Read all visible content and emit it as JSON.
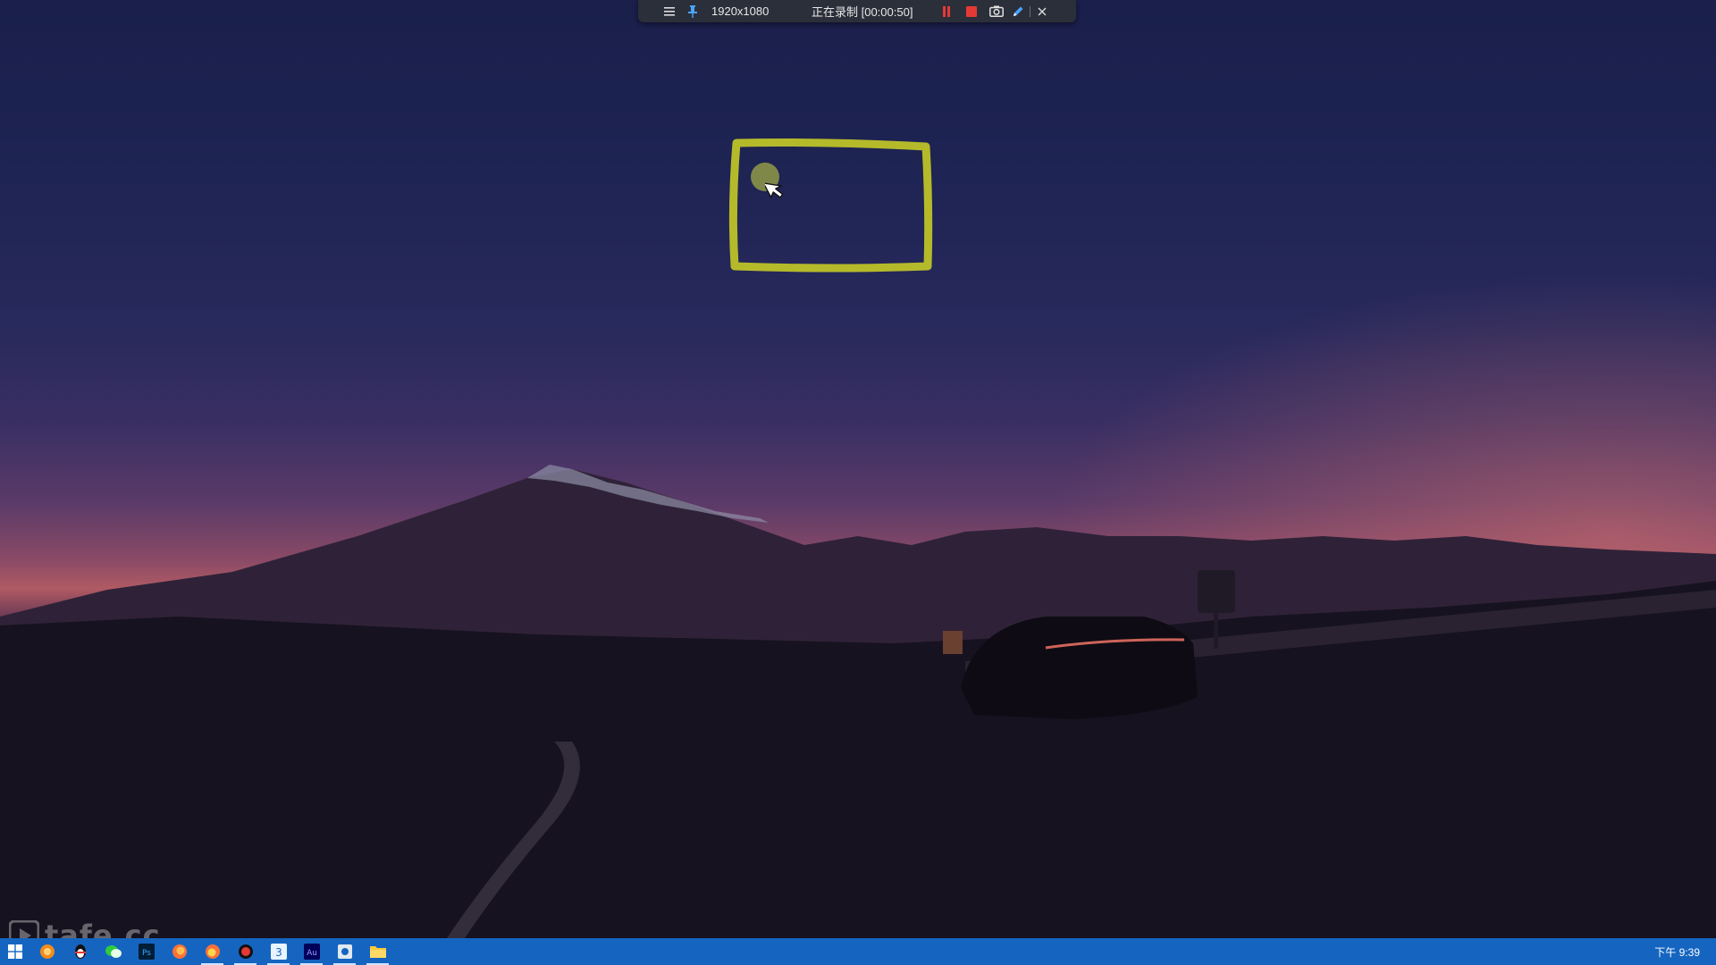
{
  "recorder_toolbar": {
    "resolution": "1920x1080",
    "status": "正在录制 [00:00:50]",
    "icons": [
      "menu-icon",
      "pin-icon",
      "pause-icon",
      "stop-icon",
      "camera-icon",
      "pen-icon",
      "close-icon"
    ],
    "colors": {
      "background": "#2b2f3a",
      "record_red": "#e53935",
      "pen_blue": "#4aa3ff"
    }
  },
  "annotation": {
    "shape": "rectangle",
    "color": "#b5ba2a"
  },
  "watermark": {
    "text": "tafe.cc"
  },
  "taskbar": {
    "apps": [
      {
        "name": "windows-start-icon"
      },
      {
        "name": "browser-orange-icon"
      },
      {
        "name": "qq-penguin-icon"
      },
      {
        "name": "wechat-icon"
      },
      {
        "name": "photoshop-icon",
        "label": "Ps"
      },
      {
        "name": "firefox-icon"
      },
      {
        "name": "firefox-alt-icon"
      },
      {
        "name": "recorder-icon"
      },
      {
        "name": "app-3-icon",
        "label": "3"
      },
      {
        "name": "audition-icon",
        "label": "Au"
      },
      {
        "name": "app-settings-icon"
      },
      {
        "name": "file-explorer-icon"
      }
    ],
    "clock": "下午 9:39",
    "color": "#1565c0"
  }
}
